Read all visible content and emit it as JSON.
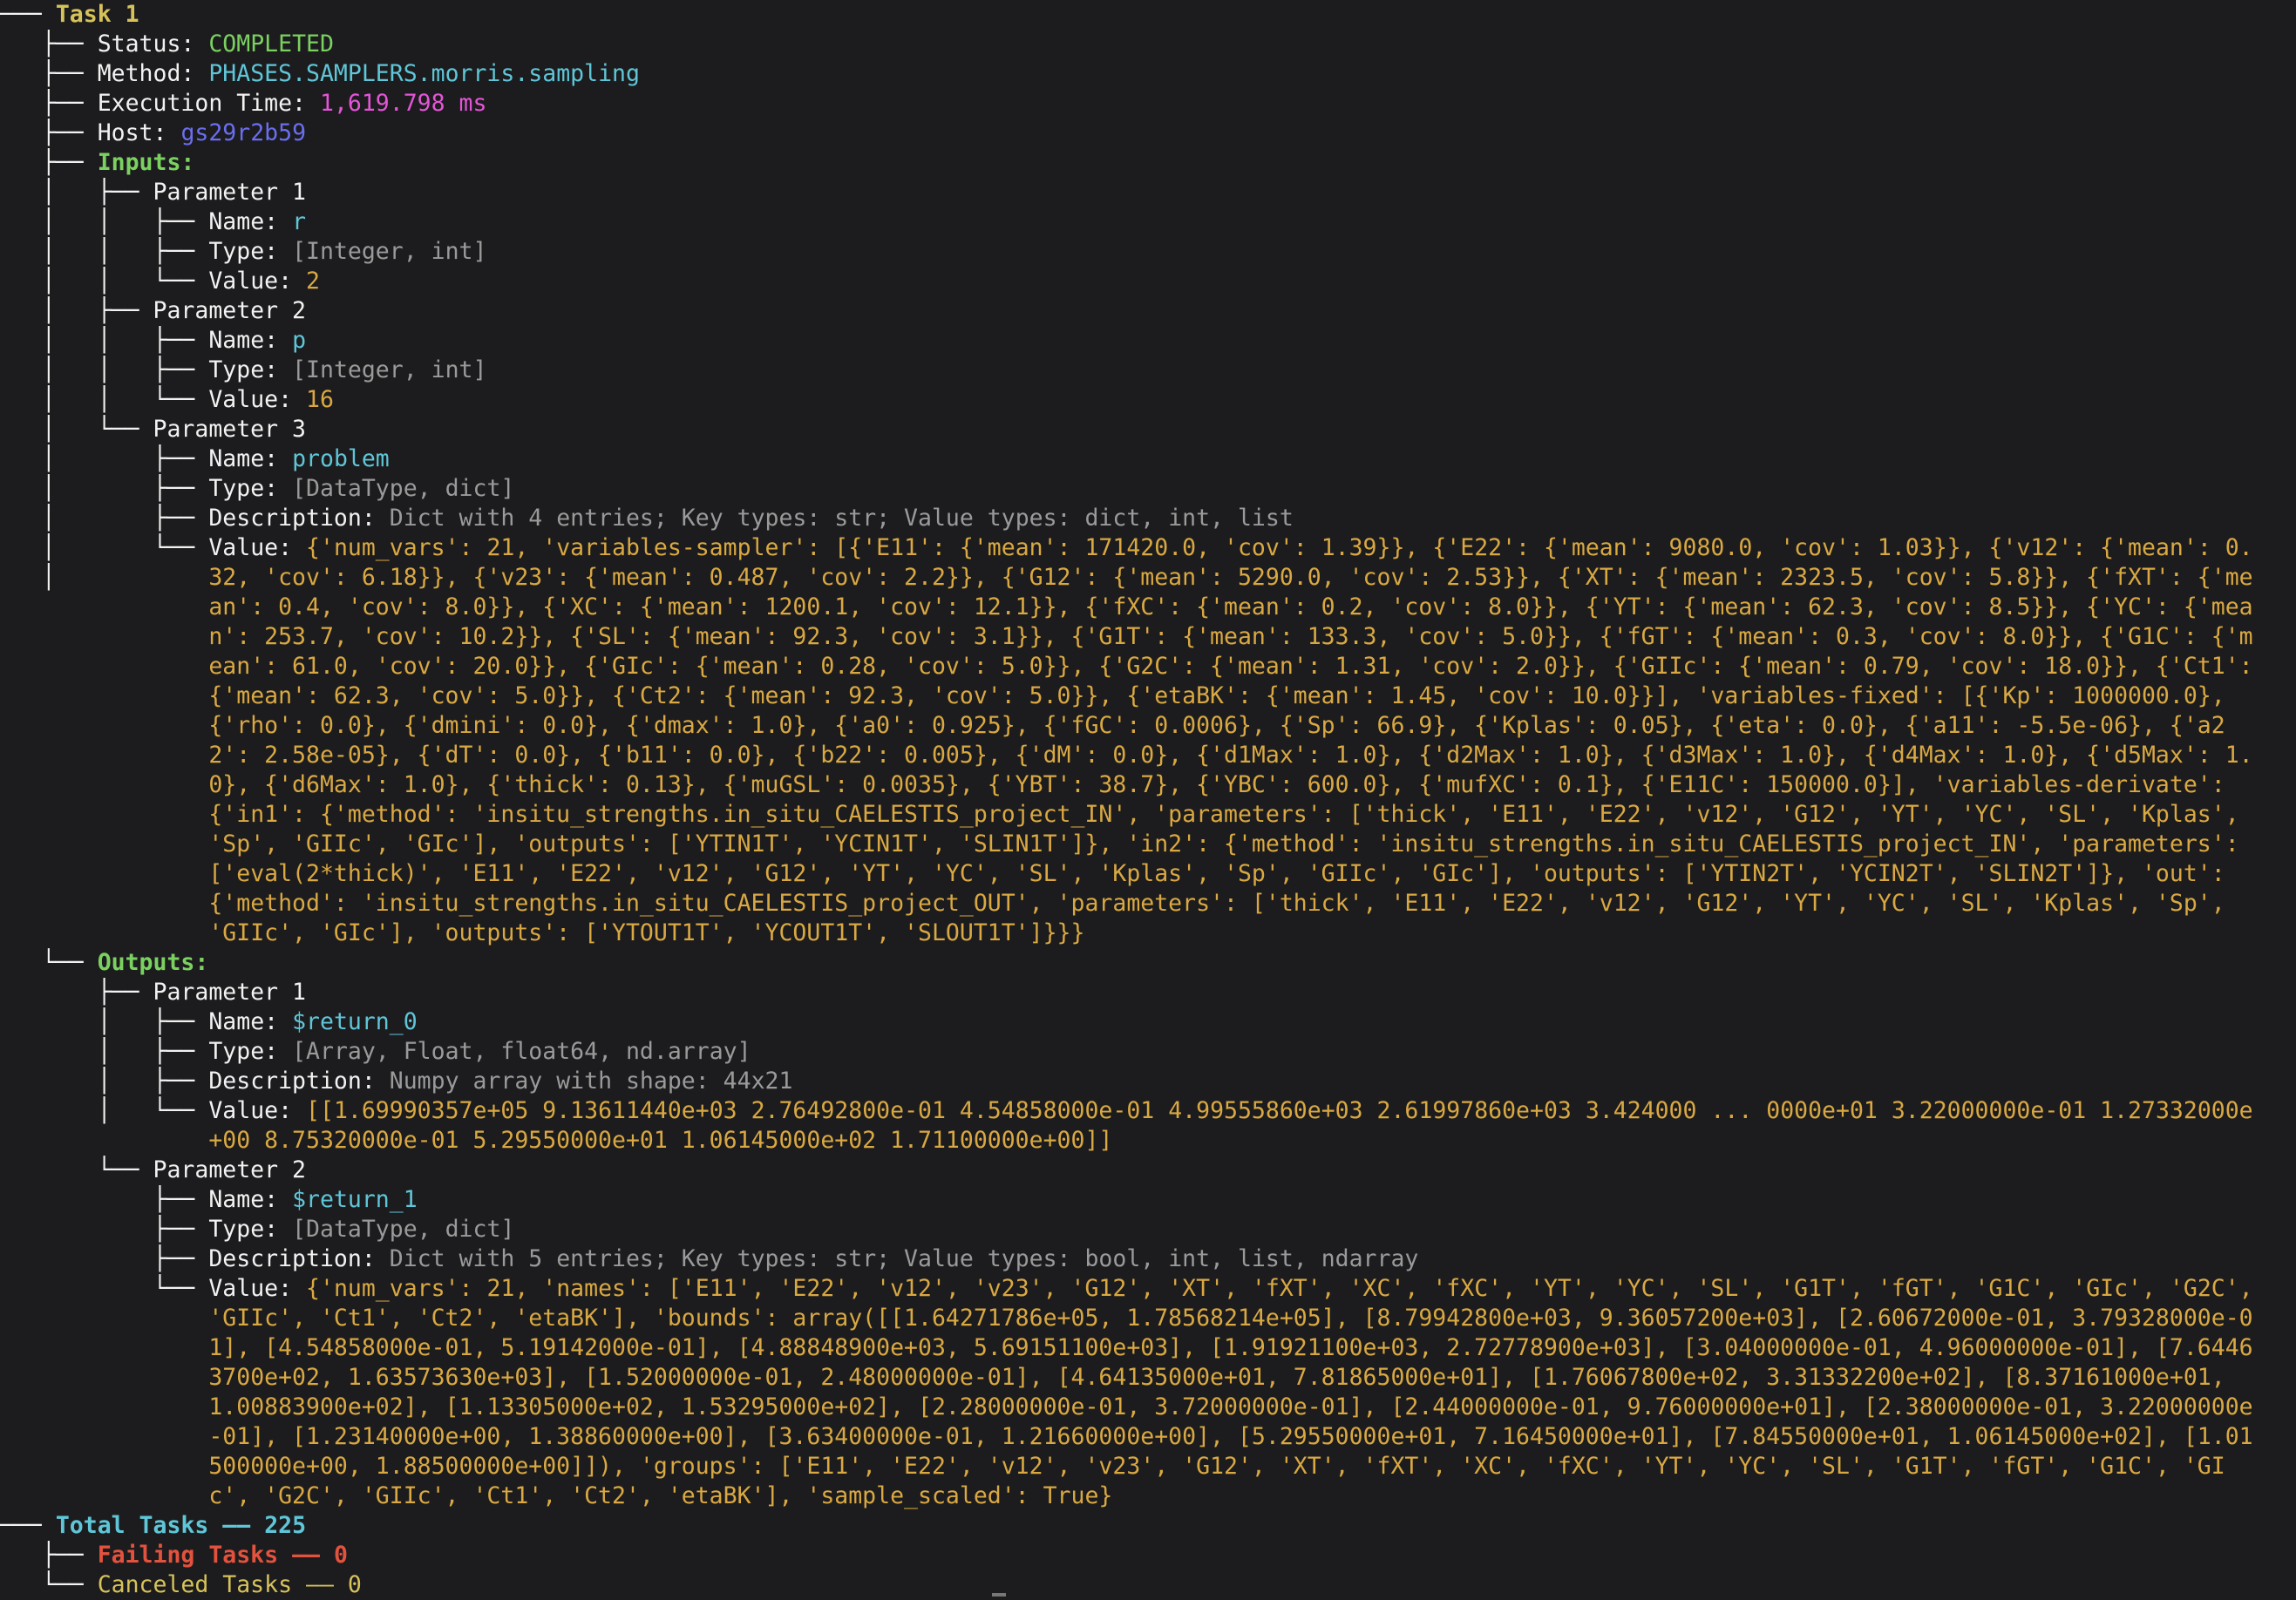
{
  "task": {
    "title": "Task 1",
    "status_label": "Status:",
    "status": "COMPLETED",
    "method_label": "Method:",
    "method": "PHASES.SAMPLERS.morris.sampling",
    "exec_label": "Execution Time:",
    "exec_time": "1,619.798 ms",
    "host_label": "Host:",
    "host": "gs29r2b59",
    "inputs_label": "Inputs:",
    "outputs_label": "Outputs:"
  },
  "labels": {
    "name": "Name:",
    "type": "Type:",
    "value": "Value:",
    "description": "Description:"
  },
  "inputs": [
    {
      "title": "Parameter 1",
      "name": "r",
      "type": "[Integer, int]",
      "value": "2"
    },
    {
      "title": "Parameter 2",
      "name": "p",
      "type": "[Integer, int]",
      "value": "16"
    },
    {
      "title": "Parameter 3",
      "name": "problem",
      "type": "[DataType, dict]",
      "description": "Dict with 4 entries; Key types: str; Value types: dict, int, list",
      "value": "{'num_vars': 21, 'variables-sampler': [{'E11': {'mean': 171420.0, 'cov': 1.39}}, {'E22': {'mean': 9080.0, 'cov': 1.03}}, {'v12': {'mean': 0.32, 'cov': 6.18}}, {'v23': {'mean': 0.487, 'cov': 2.2}}, {'G12': {'mean': 5290.0, 'cov': 2.53}}, {'XT': {'mean': 2323.5, 'cov': 5.8}}, {'fXT': {'mean': 0.4, 'cov': 8.0}}, {'XC': {'mean': 1200.1, 'cov': 12.1}}, {'fXC': {'mean': 0.2, 'cov': 8.0}}, {'YT': {'mean': 62.3, 'cov': 8.5}}, {'YC': {'mean': 253.7, 'cov': 10.2}}, {'SL': {'mean': 92.3, 'cov': 3.1}}, {'G1T': {'mean': 133.3, 'cov': 5.0}}, {'fGT': {'mean': 0.3, 'cov': 8.0}}, {'G1C': {'mean': 61.0, 'cov': 20.0}}, {'GIc': {'mean': 0.28, 'cov': 5.0}}, {'G2C': {'mean': 1.31, 'cov': 2.0}}, {'GIIc': {'mean': 0.79, 'cov': 18.0}}, {'Ct1': {'mean': 62.3, 'cov': 5.0}}, {'Ct2': {'mean': 92.3, 'cov': 5.0}}, {'etaBK': {'mean': 1.45, 'cov': 10.0}}], 'variables-fixed': [{'Kp': 1000000.0}, {'rho': 0.0}, {'dmini': 0.0}, {'dmax': 1.0}, {'a0': 0.925}, {'fGC': 0.0006}, {'Sp': 66.9}, {'Kplas': 0.05}, {'eta': 0.0}, {'a11': -5.5e-06}, {'a22': 2.58e-05}, {'dT': 0.0}, {'b11': 0.0}, {'b22': 0.005}, {'dM': 0.0}, {'d1Max': 1.0}, {'d2Max': 1.0}, {'d3Max': 1.0}, {'d4Max': 1.0}, {'d5Max': 1.0}, {'d6Max': 1.0}, {'thick': 0.13}, {'muGSL': 0.0035}, {'YBT': 38.7}, {'YBC': 600.0}, {'mufXC': 0.1}, {'E11C': 150000.0}], 'variables-derivate': {'in1': {'method': 'insitu_strengths.in_situ_CAELESTIS_project_IN', 'parameters': ['thick', 'E11', 'E22', 'v12', 'G12', 'YT', 'YC', 'SL', 'Kplas', 'Sp', 'GIIc', 'GIc'], 'outputs': ['YTIN1T', 'YCIN1T', 'SLIN1T']}, 'in2': {'method': 'insitu_strengths.in_situ_CAELESTIS_project_IN', 'parameters': ['eval(2*thick)', 'E11', 'E22', 'v12', 'G12', 'YT', 'YC', 'SL', 'Kplas', 'Sp', 'GIIc', 'GIc'], 'outputs': ['YTIN2T', 'YCIN2T', 'SLIN2T']}, 'out': {'method': 'insitu_strengths.in_situ_CAELESTIS_project_OUT', 'parameters': ['thick', 'E11', 'E22', 'v12', 'G12', 'YT', 'YC', 'SL', 'Kplas', 'Sp', 'GIIc', 'GIc'], 'outputs': ['YTOUT1T', 'YCOUT1T', 'SLOUT1T']}}}"
    }
  ],
  "outputs": [
    {
      "title": "Parameter 1",
      "name": "$return_0",
      "type": "[Array, Float, float64, nd.array]",
      "description": "Numpy array with shape: 44x21",
      "value": "[[1.69990357e+05 9.13611440e+03 2.76492800e-01 4.54858000e-01 4.99555860e+03 2.61997860e+03 3.424000 ... 0000e+01 3.22000000e-01 1.27332000e+00 8.75320000e-01 5.29550000e+01 1.06145000e+02 1.71100000e+00]]"
    },
    {
      "title": "Parameter 2",
      "name": "$return_1",
      "type": "[DataType, dict]",
      "description": "Dict with 5 entries; Key types: str; Value types: bool, int, list, ndarray",
      "value": "{'num_vars': 21, 'names': ['E11', 'E22', 'v12', 'v23', 'G12', 'XT', 'fXT', 'XC', 'fXC', 'YT', 'YC', 'SL', 'G1T', 'fGT', 'G1C', 'GIc', 'G2C', 'GIIc', 'Ct1', 'Ct2', 'etaBK'], 'bounds': array([[1.64271786e+05, 1.78568214e+05], [8.79942800e+03, 9.36057200e+03], [2.60672000e-01, 3.79328000e-01], [4.54858000e-01, 5.19142000e-01], [4.88848900e+03, 5.69151100e+03], [1.91921100e+03, 2.72778900e+03], [3.04000000e-01, 4.96000000e-01], [7.64463700e+02, 1.63573630e+03], [1.52000000e-01, 2.48000000e-01], [4.64135000e+01, 7.81865000e+01], [1.76067800e+02, 3.31332200e+02], [8.37161000e+01, 1.00883900e+02], [1.13305000e+02, 1.53295000e+02], [2.28000000e-01, 3.72000000e-01], [2.44000000e-01, 9.76000000e+01], [2.38000000e-01, 3.22000000e-01], [1.23140000e+00, 1.38860000e+00], [3.63400000e-01, 1.21660000e+00], [5.29550000e+01, 7.16450000e+01], [7.84550000e+01, 1.06145000e+02], [1.01500000e+00, 1.88500000e+00]]), 'groups': ['E11', 'E22', 'v12', 'v23', 'G12', 'XT', 'fXT', 'XC', 'fXC', 'YT', 'YC', 'SL', 'G1T', 'fGT', 'G1C', 'GIc', 'G2C', 'GIIc', 'Ct1', 'Ct2', 'etaBK'], 'sample_scaled': True}"
    }
  ],
  "summary": {
    "total_label": "Total Tasks",
    "total_value": "225",
    "failing_label": "Failing Tasks",
    "failing_value": "0",
    "canceled_label": "Canceled Tasks",
    "canceled_value": "0",
    "dash": "——"
  },
  "colors": {
    "background": "#1c1c1e",
    "title_yellow": "#d7c25a",
    "status_green": "#7bd160",
    "method_cyan": "#5fc6d8",
    "time_magenta": "#e455d8",
    "host_blue": "#6a6ef0",
    "type_gray": "#9a9a9a",
    "value_orange": "#d9a842",
    "failing_red": "#e3523d"
  }
}
